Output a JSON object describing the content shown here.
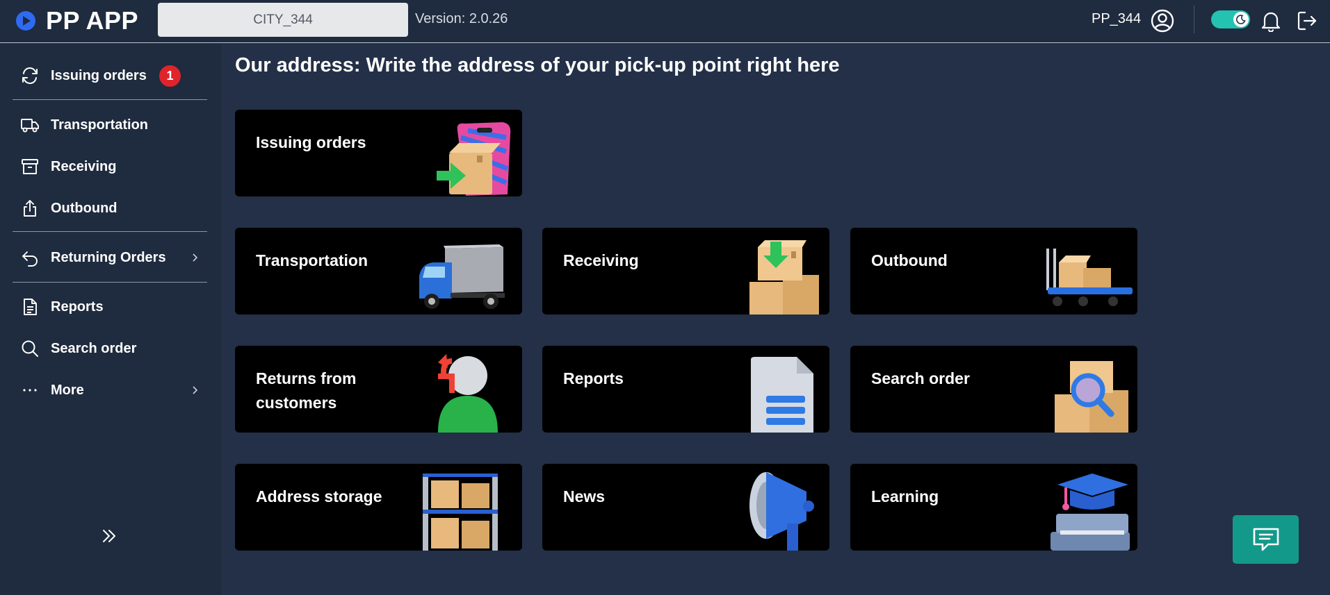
{
  "header": {
    "app_name": "PP APP",
    "city": "CITY_344",
    "version": "Version: 2.0.26",
    "user": "PP_344",
    "theme_toggle": "dark",
    "icons": [
      "play-circle-icon",
      "user-circle-icon",
      "moon-icon",
      "bell-icon",
      "logout-icon"
    ]
  },
  "sidebar": {
    "items": [
      {
        "label": "Issuing orders",
        "icon": "refresh-icon",
        "badge": "1"
      },
      {
        "label": "Transportation",
        "icon": "truck-icon"
      },
      {
        "label": "Receiving",
        "icon": "archive-icon"
      },
      {
        "label": "Outbound",
        "icon": "share-icon"
      },
      {
        "label": "Returning Orders",
        "icon": "undo-icon"
      },
      {
        "label": "Reports",
        "icon": "document-icon"
      },
      {
        "label": "Search order",
        "icon": "search-icon"
      },
      {
        "label": "More",
        "icon": "more-icon"
      }
    ]
  },
  "main": {
    "title": "Our address: Write the address of your pick-up point right here",
    "tiles": [
      {
        "label": "Issuing orders",
        "art": "box-bag-icon"
      },
      {
        "label": "Transportation",
        "art": "truck-icon"
      },
      {
        "label": "Receiving",
        "art": "boxes-download-icon"
      },
      {
        "label": "Outbound",
        "art": "cart-boxes-icon"
      },
      {
        "label": "Returns from customers",
        "art": "return-person-icon"
      },
      {
        "label": "Reports",
        "art": "report-document-icon"
      },
      {
        "label": "Search order",
        "art": "boxes-search-icon"
      },
      {
        "label": "Address storage",
        "art": "shelf-boxes-icon"
      },
      {
        "label": "News",
        "art": "megaphone-icon"
      },
      {
        "label": "Learning",
        "art": "graduation-books-icon"
      }
    ]
  },
  "colors": {
    "background": "#233047",
    "sidebar": "#1f2b3e",
    "tile": "#000000",
    "accent_teal": "#13998a",
    "badge_red": "#e0242b",
    "toggle": "#24c2b1"
  }
}
